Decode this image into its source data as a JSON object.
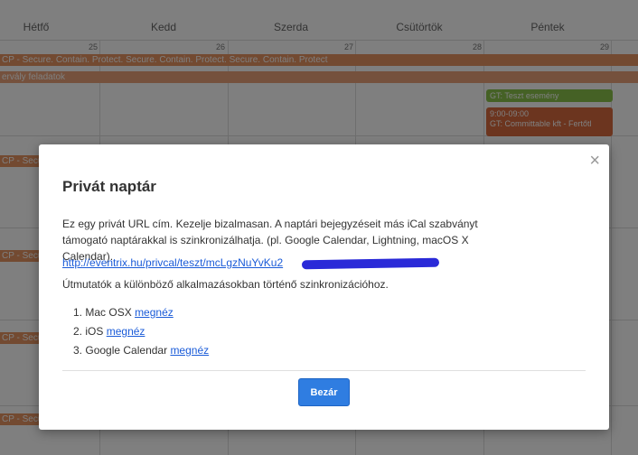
{
  "calendar": {
    "days": [
      "Hétfő",
      "Kedd",
      "Szerda",
      "Csütörtök",
      "Péntek"
    ],
    "day_numbers": [
      "25",
      "26",
      "27",
      "28",
      "29"
    ],
    "events": {
      "banner_1": "CP - Secure. Contain. Protect. Secure. Contain. Protect. Secure. Contain. Protect",
      "banner_2": "ervály feladatok",
      "pill_green": "GT: Teszt esemény",
      "block_time": "9:00-09:00",
      "block_text": "GT: Committable kft - Fertőtl",
      "row_labels": [
        "CP - Secure",
        "CP - Secure",
        "CP - Secure",
        "CP - Secure"
      ]
    }
  },
  "modal": {
    "close_symbol": "×",
    "title": "Privát naptár",
    "description": "Ez egy privát URL cím. Kezelje bizalmasan. A naptári bejegyzéseit más iCal szabványt támogató naptárakkal is szinkronizálhatja. (pl. Google Calendar, Lightning, macOS X Calendar).",
    "url": "http://eventrix.hu/privcal/teszt/mcLgzNuYvKu2",
    "guide": "Útmutatók a különböző alkalmazásokban történő szinkronizációhoz.",
    "items": [
      {
        "num": "1.",
        "label": "Mac OSX",
        "link": "megnéz"
      },
      {
        "num": "2.",
        "label": "iOS",
        "link": "megnéz"
      },
      {
        "num": "3.",
        "label": "Google Calendar",
        "link": "megnéz"
      }
    ],
    "button": "Bezár"
  },
  "colors": {
    "accent": "#2f7de1",
    "link": "#1a5bd8",
    "event_orange": "#e69463",
    "event_green": "#8ac24a",
    "event_red": "#d86a3f"
  }
}
